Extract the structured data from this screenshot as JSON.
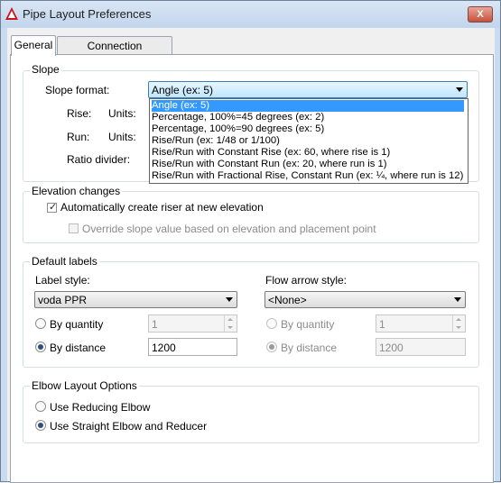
{
  "window": {
    "title": "Pipe Layout Preferences",
    "close_label": "X"
  },
  "tabs": [
    {
      "label": "General",
      "active": true
    },
    {
      "label": "Connection Assignments",
      "active": false
    }
  ],
  "slope": {
    "group_label": "Slope",
    "format_label": "Slope format:",
    "format_value": "Angle (ex: 5)",
    "rise_label": "Rise:",
    "run_label": "Run:",
    "units_label": "Units:",
    "ratio_divider_label": "Ratio divider:",
    "format_options": [
      "Angle (ex: 5)",
      "Percentage, 100%=45 degrees (ex: 2)",
      "Percentage, 100%=90 degrees (ex: 5)",
      "Rise/Run (ex: 1/48 or 1/100)",
      "Rise/Run with Constant Rise (ex: 60, where rise is 1)",
      "Rise/Run with Constant Run (ex: 20, where run is 1)",
      "Rise/Run with Fractional Rise, Constant Run (ex: ¼, where run is 12)"
    ],
    "selected_index": 0
  },
  "elevation": {
    "group_label": "Elevation changes",
    "create_riser_label": "Automatically create riser at new elevation",
    "create_riser_checked": true,
    "override_label": "Override slope value based on elevation and placement point",
    "override_checked": false
  },
  "default_labels": {
    "group_label": "Default labels",
    "label_style_label": "Label style:",
    "label_style_value": "voda PPR",
    "by_quantity_label": "By quantity",
    "by_distance_label": "By distance",
    "quantity_value": "1",
    "distance_value": "1200",
    "label_mode": "by_distance",
    "flow_arrow_label": "Flow arrow style:",
    "flow_arrow_value": "<None>",
    "flow_by_quantity_label": "By quantity",
    "flow_by_distance_label": "By distance",
    "flow_quantity_value": "1",
    "flow_distance_value": "1200",
    "flow_mode": "by_distance"
  },
  "elbow": {
    "group_label": "Elbow Layout Options",
    "reducing_label": "Use Reducing Elbow",
    "straight_label": "Use Straight Elbow and Reducer",
    "selected": "straight"
  },
  "colors": {
    "selection": "#3399ff",
    "titlebar": "#c9dbef"
  }
}
